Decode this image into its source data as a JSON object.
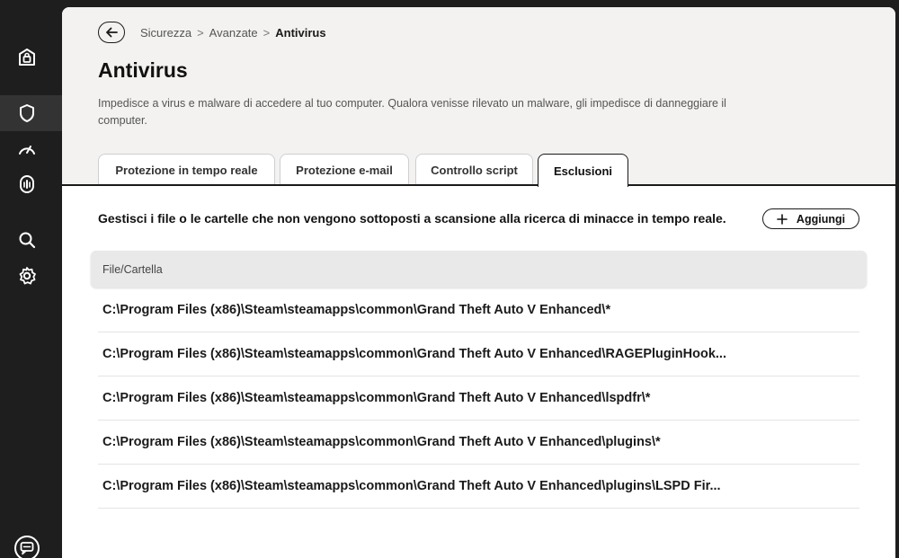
{
  "sidebar": {
    "items": [
      {
        "icon": "home-shield-icon"
      },
      {
        "icon": "shield-icon"
      },
      {
        "icon": "speedometer-icon"
      },
      {
        "icon": "fingerprint-icon"
      },
      {
        "icon": "search-icon"
      },
      {
        "icon": "gear-icon"
      },
      {
        "icon": "chat-support-icon"
      }
    ]
  },
  "breadcrumb": {
    "items": [
      "Sicurezza",
      "Avanzate",
      "Antivirus"
    ],
    "separator": ">"
  },
  "page": {
    "title": "Antivirus",
    "description": "Impedisce a virus e malware di accedere al tuo computer. Qualora venisse rilevato un malware, gli impedisce di danneggiare il computer."
  },
  "tabs": [
    {
      "label": "Protezione in tempo reale",
      "active": false
    },
    {
      "label": "Protezione e-mail",
      "active": false
    },
    {
      "label": "Controllo script",
      "active": false
    },
    {
      "label": "Esclusioni",
      "active": true
    }
  ],
  "exclusions": {
    "intro": "Gestisci i file o le cartelle che non vengono sottoposti a scansione alla ricerca di minacce in tempo reale.",
    "add_label": "Aggiungi",
    "column_header": "File/Cartella",
    "rows": [
      "C:\\Program Files (x86)\\Steam\\steamapps\\common\\Grand Theft Auto V Enhanced\\*",
      "C:\\Program Files (x86)\\Steam\\steamapps\\common\\Grand Theft Auto V Enhanced\\RAGEPluginHook...",
      "C:\\Program Files (x86)\\Steam\\steamapps\\common\\Grand Theft Auto V Enhanced\\lspdfr\\*",
      "C:\\Program Files (x86)\\Steam\\steamapps\\common\\Grand Theft Auto V Enhanced\\plugins\\*",
      "C:\\Program Files (x86)\\Steam\\steamapps\\common\\Grand Theft Auto V Enhanced\\plugins\\LSPD Fir..."
    ]
  },
  "colors": {
    "sidebar_bg": "#1e1e1e",
    "header_bg": "#f3f2f0",
    "content_bg": "#ffffff",
    "accent": "#1a1a1a"
  }
}
